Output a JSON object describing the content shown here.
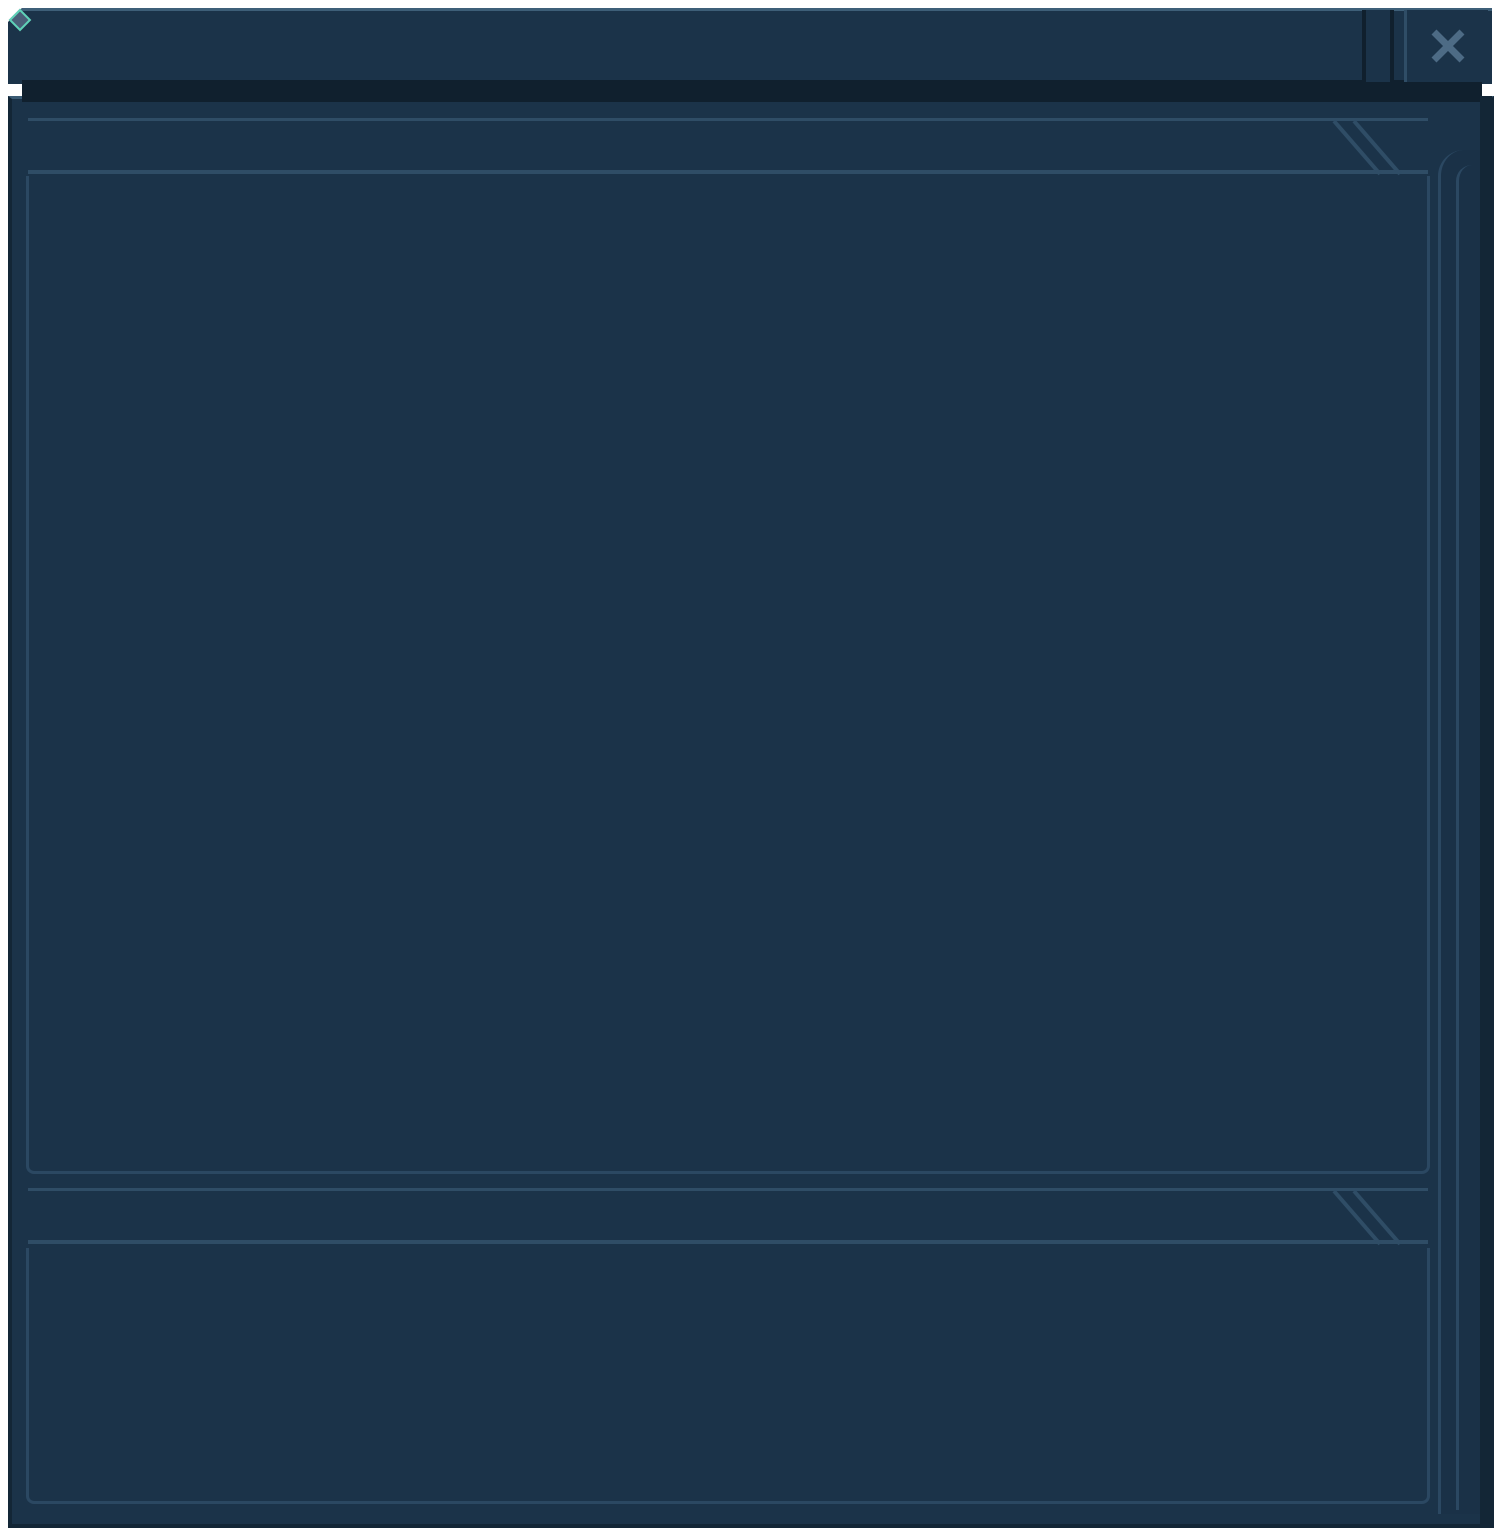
{
  "window": {
    "close_icon": "close-x-icon",
    "colors": {
      "panel": "#1b3349",
      "border_light": "#3b5b74",
      "border_dark": "#10202e",
      "accent": "#5fd2b8",
      "icon": "#4d6b85"
    }
  }
}
